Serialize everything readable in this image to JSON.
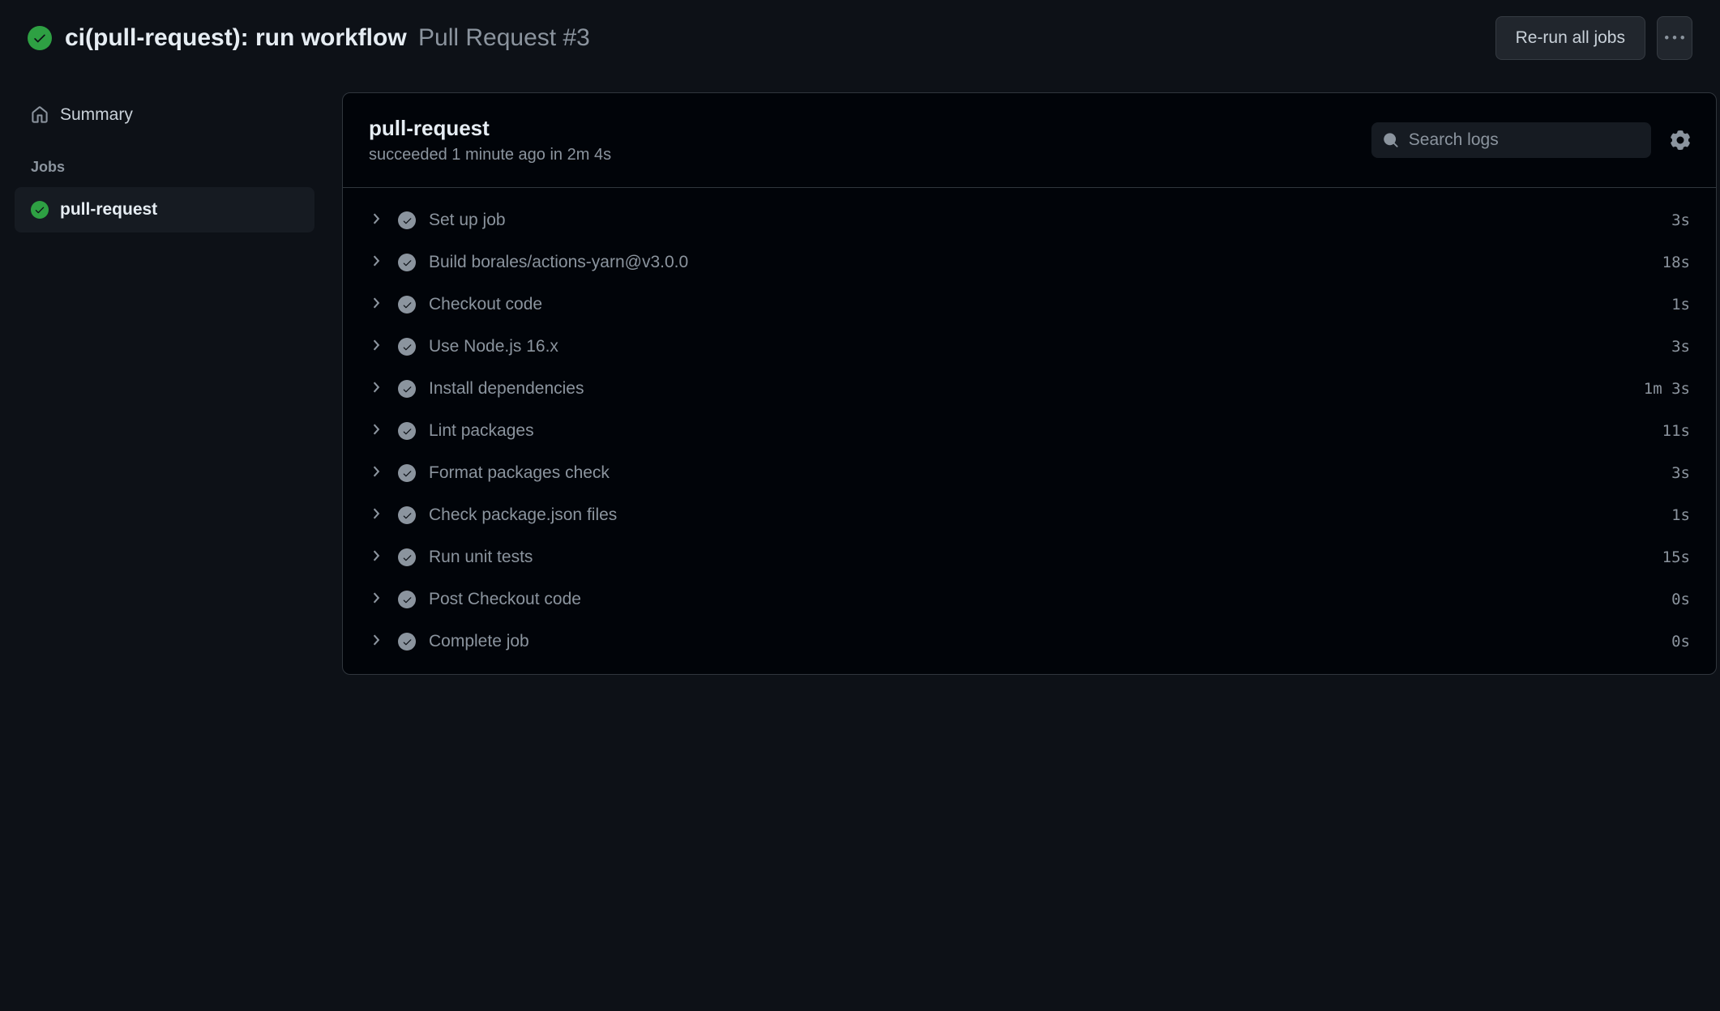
{
  "header": {
    "title": "ci(pull-request): run workflow",
    "subtitle": "Pull Request #3",
    "rerun_label": "Re-run all jobs"
  },
  "sidebar": {
    "summary_label": "Summary",
    "jobs_heading": "Jobs",
    "jobs": [
      {
        "name": "pull-request",
        "status": "success",
        "active": true
      }
    ]
  },
  "main": {
    "job_title": "pull-request",
    "status_line": "succeeded 1 minute ago in 2m 4s",
    "search_placeholder": "Search logs",
    "steps": [
      {
        "name": "Set up job",
        "duration": "3s",
        "status": "success"
      },
      {
        "name": "Build borales/actions-yarn@v3.0.0",
        "duration": "18s",
        "status": "success"
      },
      {
        "name": "Checkout code",
        "duration": "1s",
        "status": "success"
      },
      {
        "name": "Use Node.js 16.x",
        "duration": "3s",
        "status": "success"
      },
      {
        "name": "Install dependencies",
        "duration": "1m 3s",
        "status": "success"
      },
      {
        "name": "Lint packages",
        "duration": "11s",
        "status": "success"
      },
      {
        "name": "Format packages check",
        "duration": "3s",
        "status": "success"
      },
      {
        "name": "Check package.json files",
        "duration": "1s",
        "status": "success"
      },
      {
        "name": "Run unit tests",
        "duration": "15s",
        "status": "success"
      },
      {
        "name": "Post Checkout code",
        "duration": "0s",
        "status": "success"
      },
      {
        "name": "Complete job",
        "duration": "0s",
        "status": "success"
      }
    ]
  }
}
